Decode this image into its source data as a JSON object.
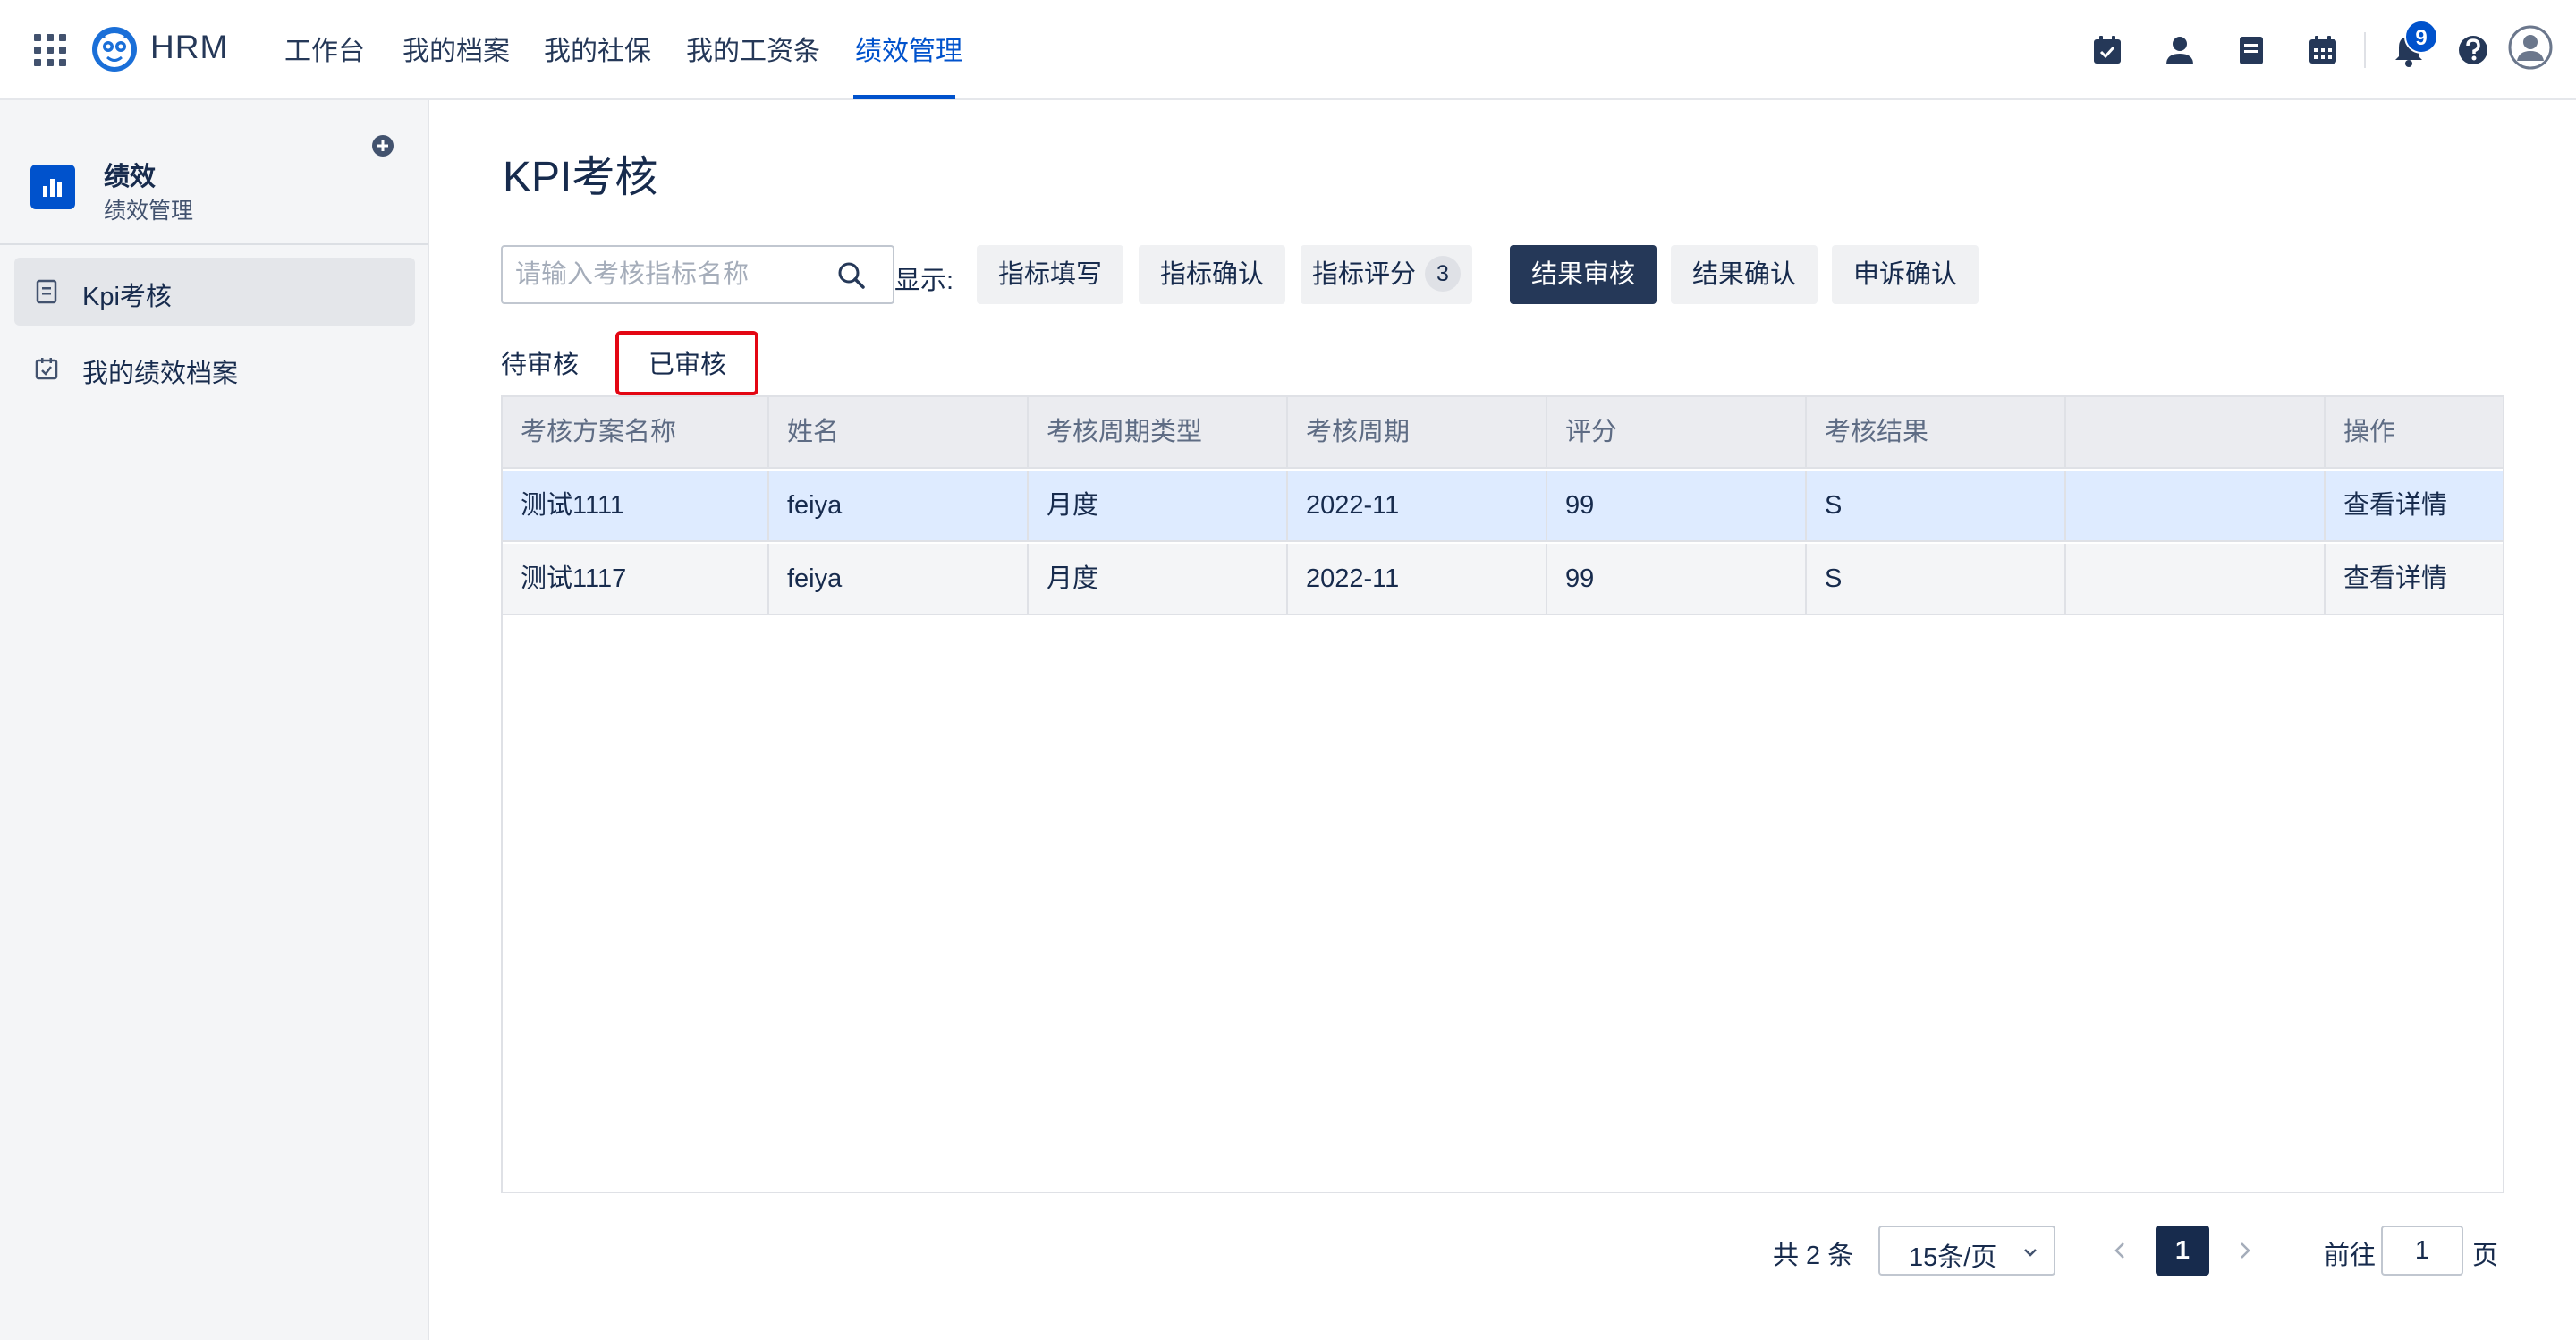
{
  "topbar": {
    "brand": "HRM",
    "nav": [
      "工作台",
      "我的档案",
      "我的社保",
      "我的工资条",
      "绩效管理"
    ],
    "active_nav": "绩效管理",
    "notification_count": "9"
  },
  "sidebar": {
    "title": "绩效",
    "subtitle": "绩效管理",
    "items": [
      {
        "label": "Kpi考核",
        "icon": "document-icon"
      },
      {
        "label": "我的绩效档案",
        "icon": "calendar-check-icon"
      }
    ]
  },
  "main": {
    "title": "KPI考核",
    "search_placeholder": "请输入考核指标名称",
    "show_label": "显示:",
    "filters": [
      {
        "label": "指标填写"
      },
      {
        "label": "指标确认"
      },
      {
        "label": "指标评分",
        "count": "3"
      },
      {
        "label": "结果审核"
      },
      {
        "label": "结果确认"
      },
      {
        "label": "申诉确认"
      }
    ],
    "active_filter": "结果审核",
    "subtabs": [
      "待审核",
      "已审核"
    ],
    "active_subtab": "已审核"
  },
  "table": {
    "columns": [
      "考核方案名称",
      "姓名",
      "考核周期类型",
      "考核周期",
      "评分",
      "考核结果",
      "",
      "操作"
    ],
    "rows": [
      [
        "测试1111",
        "feiya",
        "月度",
        "2022-11",
        "99",
        "S",
        "",
        "查看详情"
      ],
      [
        "测试1117",
        "feiya",
        "月度",
        "2022-11",
        "99",
        "S",
        "",
        "查看详情"
      ]
    ]
  },
  "pagination": {
    "total": "共 2 条",
    "page_size": "15条/页",
    "current_page": "1",
    "goto_label": "前往",
    "goto_value": "1",
    "page_unit": "页"
  },
  "colors": {
    "primary": "#0052cc",
    "dark": "#253858",
    "selected_row": "#deebff",
    "highlight_box": "#e30613"
  }
}
